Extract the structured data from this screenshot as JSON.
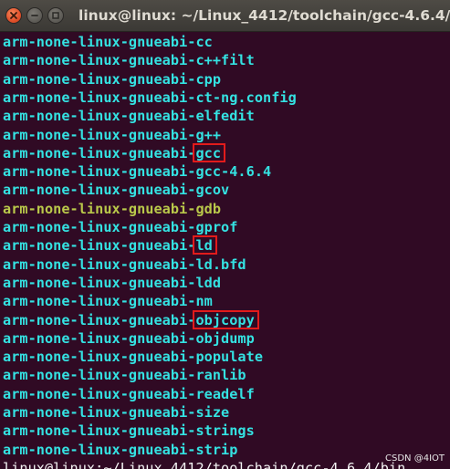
{
  "window": {
    "title": "linux@linux: ~/Linux_4412/toolchain/gcc-4.6.4/bin"
  },
  "terminal": {
    "prefix": "arm-none-linux-gnueabi-",
    "lines": [
      {
        "suffix": "cc"
      },
      {
        "suffix": "c++filt"
      },
      {
        "suffix": "cpp"
      },
      {
        "suffix": "ct-ng.config"
      },
      {
        "suffix": "elfedit"
      },
      {
        "suffix": "g++"
      },
      {
        "suffix": "gcc",
        "highlighted": true
      },
      {
        "suffix": "gcc-4.6.4"
      },
      {
        "suffix": "gcov"
      },
      {
        "suffix": "gdb",
        "color": "#b9c84a"
      },
      {
        "suffix": "gprof"
      },
      {
        "suffix": "ld",
        "highlighted": true
      },
      {
        "suffix": "ld.bfd"
      },
      {
        "suffix": "ldd"
      },
      {
        "suffix": "nm"
      },
      {
        "suffix": "objcopy",
        "highlighted": true
      },
      {
        "suffix": "objdump"
      },
      {
        "suffix": "populate"
      },
      {
        "suffix": "ranlib"
      },
      {
        "suffix": "readelf"
      },
      {
        "suffix": "size"
      },
      {
        "suffix": "strings"
      },
      {
        "suffix": "strip"
      }
    ],
    "prompt": "linux@linux:~/Linux_4412/toolchain/gcc-4.6.4/bin"
  },
  "watermark": "CSDN @4IOT",
  "colors": {
    "background": "#300a24",
    "file_text": "#34e2e2",
    "gdb_text": "#b9c84a",
    "highlight_box": "#e21b1b",
    "title_text": "#dfdbd2"
  },
  "icons": [
    "close-icon",
    "minimize-icon",
    "maximize-icon"
  ]
}
